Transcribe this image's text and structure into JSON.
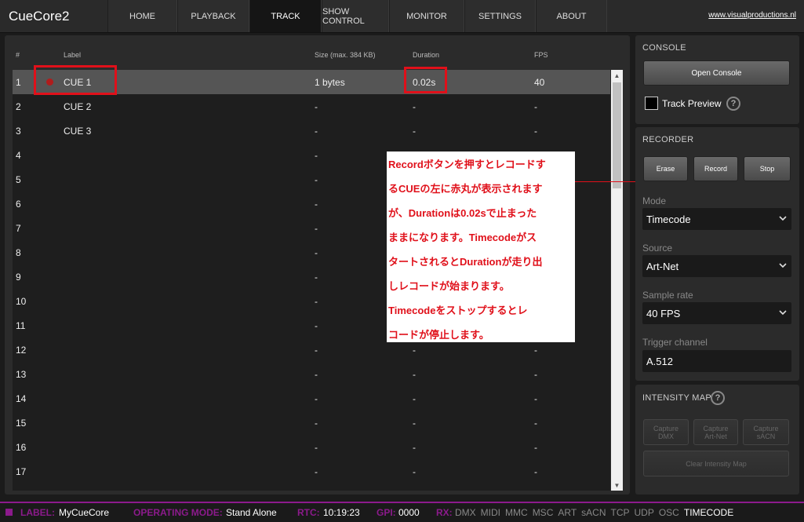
{
  "app": {
    "title": "CueCore2",
    "link": "www.visualproductions.nl"
  },
  "nav": {
    "tabs": [
      "HOME",
      "PLAYBACK",
      "TRACK",
      "SHOW CONTROL",
      "MONITOR",
      "SETTINGS",
      "ABOUT"
    ],
    "active": "TRACK"
  },
  "table": {
    "headers": {
      "num": "#",
      "label": "Label",
      "size": "Size (max. 384 KB)",
      "duration": "Duration",
      "fps": "FPS"
    },
    "rows": [
      {
        "num": "1",
        "label": "CUE 1",
        "size": "1 bytes",
        "duration": "0.02s",
        "fps": "40",
        "recording": true,
        "selected": true
      },
      {
        "num": "2",
        "label": "CUE 2",
        "size": "-",
        "duration": "-",
        "fps": "-"
      },
      {
        "num": "3",
        "label": "CUE 3",
        "size": "-",
        "duration": "-",
        "fps": "-"
      },
      {
        "num": "4",
        "label": "",
        "size": "-",
        "duration": "-",
        "fps": "-"
      },
      {
        "num": "5",
        "label": "",
        "size": "-",
        "duration": "-",
        "fps": "-"
      },
      {
        "num": "6",
        "label": "",
        "size": "-",
        "duration": "-",
        "fps": "-"
      },
      {
        "num": "7",
        "label": "",
        "size": "-",
        "duration": "-",
        "fps": "-"
      },
      {
        "num": "8",
        "label": "",
        "size": "-",
        "duration": "-",
        "fps": "-"
      },
      {
        "num": "9",
        "label": "",
        "size": "-",
        "duration": "-",
        "fps": "-"
      },
      {
        "num": "10",
        "label": "",
        "size": "-",
        "duration": "-",
        "fps": "-"
      },
      {
        "num": "11",
        "label": "",
        "size": "-",
        "duration": "-",
        "fps": "-"
      },
      {
        "num": "12",
        "label": "",
        "size": "-",
        "duration": "-",
        "fps": "-"
      },
      {
        "num": "13",
        "label": "",
        "size": "-",
        "duration": "-",
        "fps": "-"
      },
      {
        "num": "14",
        "label": "",
        "size": "-",
        "duration": "-",
        "fps": "-"
      },
      {
        "num": "15",
        "label": "",
        "size": "-",
        "duration": "-",
        "fps": "-"
      },
      {
        "num": "16",
        "label": "",
        "size": "-",
        "duration": "-",
        "fps": "-"
      },
      {
        "num": "17",
        "label": "",
        "size": "-",
        "duration": "-",
        "fps": "-"
      }
    ]
  },
  "annotation": {
    "text": "RecordボタンをおすとレコードするCUEの左に赤丸が表示されますが、Durationは0.02sで止まったままになります。Timecodeがスタートされるとdurationが走り出しレコードが始まります。Timecodeをストップするとレコードが停止します。",
    "lines": [
      "Recordボタンを押すとレコードす",
      "るCUEの左に赤丸が表示されます",
      "が、Durationは0.02sで止まった",
      "ままになります。Timecodeがス",
      "タートされるとDurationが走り出",
      "しレコードが始まります。",
      "Timecodeをストップするとレ",
      "コードが停止します。"
    ]
  },
  "console": {
    "title": "CONSOLE",
    "open_button": "Open Console",
    "track_preview": "Track Preview",
    "track_preview_checked": false
  },
  "recorder": {
    "title": "RECORDER",
    "buttons": {
      "erase": "Erase",
      "record": "Record",
      "stop": "Stop"
    },
    "mode": {
      "label": "Mode",
      "value": "Timecode"
    },
    "source": {
      "label": "Source",
      "value": "Art-Net"
    },
    "sample_rate": {
      "label": "Sample rate",
      "value": "40 FPS"
    },
    "trigger_channel": {
      "label": "Trigger channel",
      "value": "A.512"
    }
  },
  "intensity_map": {
    "title": "INTENSITY MAP",
    "capture_dmx": "Capture DMX",
    "capture_artnet": "Capture Art-Net",
    "capture_sacn": "Capture sACN",
    "clear": "Clear Intensity Map"
  },
  "status": {
    "label_key": "LABEL:",
    "label_val": "MyCueCore",
    "mode_key": "OPERATING MODE:",
    "mode_val": "Stand Alone",
    "rtc_key": "RTC:",
    "rtc_val": "10:19:23",
    "gpi_key": "GPI:",
    "gpi_val": "0000",
    "rx_key": "RX:",
    "rx_items": [
      "DMX",
      "MIDI",
      "MMC",
      "MSC",
      "ART",
      "sACN",
      "TCP",
      "UDP",
      "OSC"
    ],
    "rx_active": "TIMECODE"
  },
  "colors": {
    "accent": "#8c1a8c",
    "highlight": "#e0101a",
    "record_dot": "#b01c1c"
  }
}
